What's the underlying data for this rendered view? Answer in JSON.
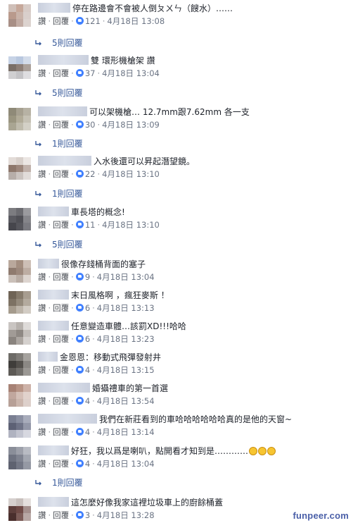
{
  "actions": {
    "like": "讚",
    "reply": "回覆"
  },
  "comments": [
    {
      "text": "停在路邊會不會被人倒ㄆㄨㄣ（餿水）……",
      "likes": "121",
      "time": "4月18日 13:08",
      "replies": "5則回覆",
      "name_prefix": "……"
    },
    {
      "text": "雙 環形機槍架  讚",
      "likes": "37",
      "time": "4月18日 13:04",
      "replies": "5則回覆"
    },
    {
      "text": "可以架機槍… 12.7mm跟7.62mm 各一支",
      "likes": "30",
      "time": "4月18日 13:09",
      "replies": "1則回覆"
    },
    {
      "text": "入水後還可以昇起潛望鏡。",
      "likes": "22",
      "time": "4月18日 13:10",
      "replies": "1則回覆"
    },
    {
      "text": "車長塔的概念!",
      "likes": "11",
      "time": "4月18日 13:10",
      "replies": "5則回覆"
    },
    {
      "text": "很像存錢桶背面的塞子",
      "likes": "9",
      "time": "4月18日 13:04"
    },
    {
      "text": "末日風格啊 ，瘋狂麥斯 ！",
      "likes": "6",
      "time": "4月18日 13:13"
    },
    {
      "text": "任意變造車體…該罰XD!!!哈哈",
      "likes": "6",
      "time": "4月18日 13:23"
    },
    {
      "text": "金恩恩：移動式飛彈發射井",
      "likes": "4",
      "time": "4月18日 13:15"
    },
    {
      "text": "婚攝禮車的第一首選",
      "likes": "4",
      "time": "4月18日 13:54"
    },
    {
      "text": "我們在新莊看到的車哈哈哈哈哈哈真的是他的天窗~",
      "likes": "4",
      "time": "4月18日 13:14"
    },
    {
      "text": "好狂，我以爲是喇叭，點開看才知到是…………",
      "likes": "4",
      "time": "4月18日 13:04",
      "replies": "1則回覆",
      "emoji": [
        "🤣",
        "🤣",
        "🤣"
      ]
    },
    {
      "text": "這怎麼好像我家這裡垃圾車上的廚餘桶蓋",
      "likes": "3",
      "time": "4月18日 13:28"
    }
  ],
  "watermark": "funpeer.com",
  "colors": {
    "link": "#365899",
    "like": "#4080ff",
    "meta": "#90949c",
    "text": "#1d2129"
  }
}
